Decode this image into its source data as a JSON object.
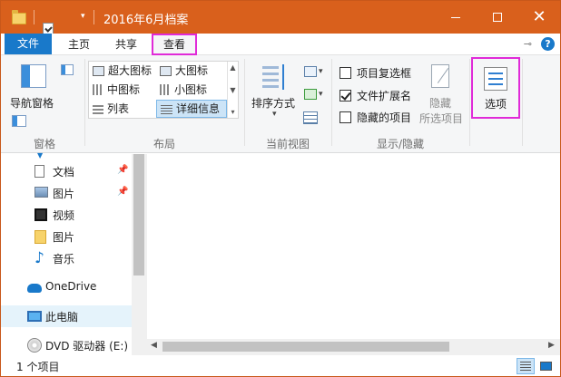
{
  "window": {
    "title": "2016年6月档案"
  },
  "ribbon_tabs": [
    {
      "label": "文件"
    },
    {
      "label": "主页"
    },
    {
      "label": "共享"
    },
    {
      "label": "查看"
    }
  ],
  "ribbon": {
    "panes": {
      "nav_pane_label": "导航窗格",
      "group_label": "窗格"
    },
    "layout": {
      "items": [
        {
          "label": "超大图标"
        },
        {
          "label": "大图标"
        },
        {
          "label": "中图标"
        },
        {
          "label": "小图标"
        },
        {
          "label": "列表"
        },
        {
          "label": "详细信息"
        }
      ],
      "selected": "详细信息",
      "group_label": "布局"
    },
    "current_view": {
      "sort_label": "排序方式",
      "group_label": "当前视图"
    },
    "show_hide": {
      "checkboxes": [
        {
          "label": "项目复选框",
          "checked": false
        },
        {
          "label": "文件扩展名",
          "checked": true
        },
        {
          "label": "隐藏的项目",
          "checked": false
        }
      ],
      "hide_label_line1": "隐藏",
      "hide_label_line2": "所选项目",
      "group_label": "显示/隐藏"
    },
    "options_label": "选项"
  },
  "nav_pane": {
    "items": [
      {
        "label": "文档",
        "icon": "document-icon",
        "pinned": true
      },
      {
        "label": "图片",
        "icon": "pictures-icon",
        "pinned": true
      },
      {
        "label": "视频",
        "icon": "video-icon",
        "pinned": false
      },
      {
        "label": "图片",
        "icon": "folder-icon",
        "pinned": false
      },
      {
        "label": "音乐",
        "icon": "music-icon",
        "pinned": false
      },
      {
        "label": "OneDrive",
        "icon": "onedrive-icon",
        "pinned": false
      },
      {
        "label": "此电脑",
        "icon": "this-pc-icon",
        "pinned": false,
        "selected": true
      },
      {
        "label": "DVD 驱动器 (E:) ：",
        "icon": "dvd-drive-icon",
        "pinned": false
      }
    ]
  },
  "status": {
    "item_count": "1 个项目"
  },
  "colors": {
    "titlebar": "#d9601c",
    "accent": "#1979ca",
    "highlight": "#e02ad8"
  }
}
